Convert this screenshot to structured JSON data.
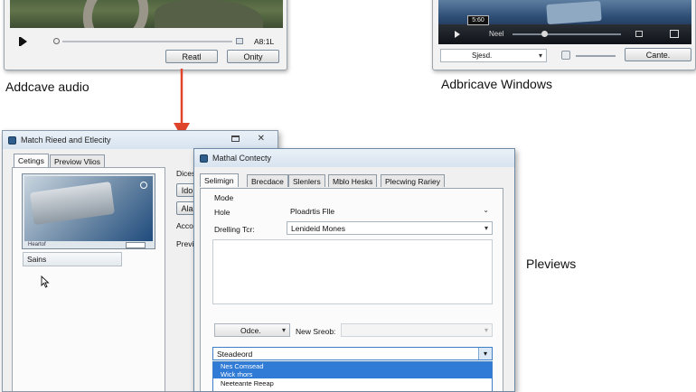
{
  "player_top_left": {
    "time_text": "A8:1L",
    "buttons": [
      "Reatl",
      "Onity"
    ]
  },
  "caption_left": "Addcave audio",
  "player_top_right": {
    "badge": "5:60",
    "time_text": "Neel",
    "select_value": "Sjesd.",
    "button": "Cante."
  },
  "caption_right": "Adbricave Windows",
  "caption_previews": "Pleviews",
  "window_a": {
    "title": "Match Rieed and Etlecity",
    "tabs": [
      "Cetings",
      "Previow Vlios"
    ],
    "thumb_caption": "Heartof",
    "list_header": "Sains",
    "side_labels": [
      "Dicesd",
      "Acco",
      "Previ"
    ],
    "side_buttons": [
      "Ido",
      "Ala"
    ]
  },
  "window_b": {
    "title": "Mathal Contecty",
    "tabs": [
      "Selimign",
      "Brecdace",
      "Slenlers",
      "Mblo Hesks",
      "Plecwing Rariey"
    ],
    "group_label": "Mode",
    "rows": [
      {
        "label": "Hole",
        "value": "Ploadrtis Flle"
      },
      {
        "label": "Drelling Tcr:",
        "value": "Lenideid Mones"
      }
    ],
    "bottom_select": "Odce.",
    "new_label": "New Sreob:",
    "dropdown_value": "Steadeord",
    "dropdown_options": [
      {
        "text": "Nes Comsead",
        "highlighted": true
      },
      {
        "text": "Wick rhors",
        "highlighted": true
      },
      {
        "text": "Neeteante Reeap",
        "highlighted": false
      }
    ]
  }
}
